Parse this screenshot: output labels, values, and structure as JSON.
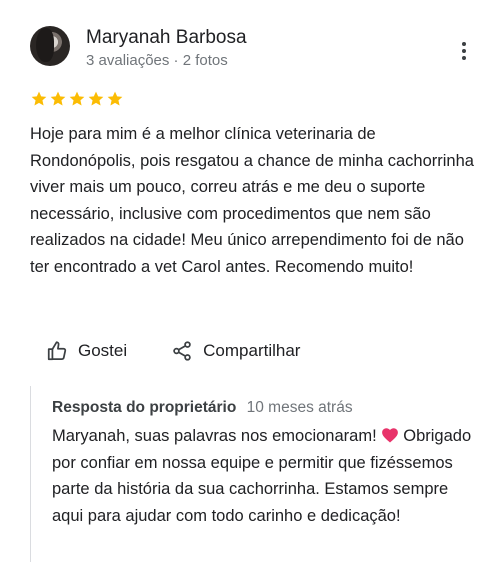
{
  "reviewer": {
    "name": "Maryanah Barbosa",
    "meta": "3 avaliações · 2 fotos"
  },
  "rating": {
    "value": 5,
    "max": 5,
    "color": "#fbbc04"
  },
  "review": {
    "text": "Hoje para mim é a melhor clínica veterinaria de Rondonópolis, pois resgatou a chance de minha cachorrinha viver mais um pouco, correu atrás e me deu o suporte necessário, inclusive com procedimentos que nem são realizados na cidade! Meu único arrependimento foi de não ter encontrado a vet Carol antes. Recomendo muito!"
  },
  "actions": {
    "like_label": "Gostei",
    "share_label": "Compartilhar"
  },
  "owner_reply": {
    "label": "Resposta do proprietário",
    "time": "10 meses atrás",
    "text": "Maryanah, suas palavras nos emocionaram!",
    "text_continued": "Obrigado por confiar em nossa equipe e permitir que fizéssemos parte da história da sua cachorrinha. Estamos sempre aqui para ajudar com todo carinho e dedicação!",
    "emoji": "heart-icon",
    "emoji_color": "#e8336a"
  },
  "icons": {
    "more": "more-vert-icon",
    "like": "thumb-up-icon",
    "share": "share-icon",
    "star": "star-icon"
  }
}
